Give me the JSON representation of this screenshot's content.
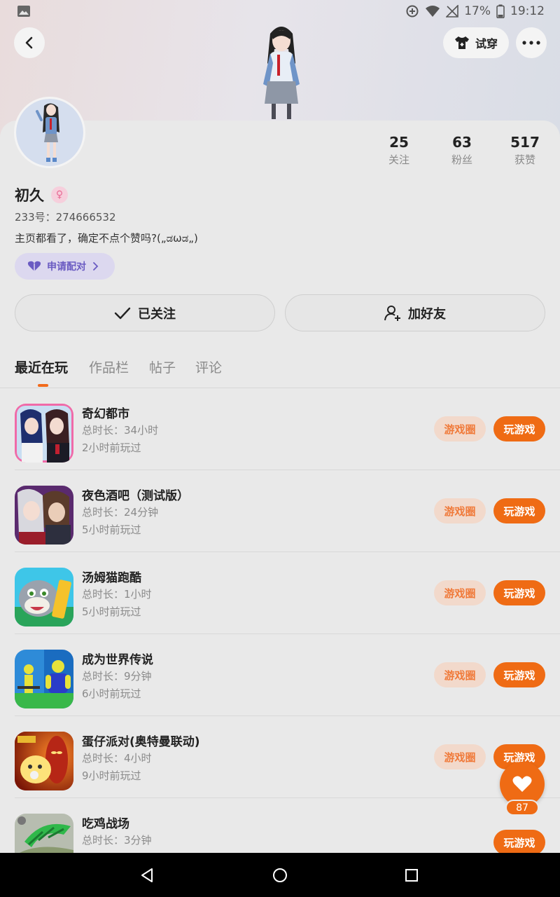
{
  "status_bar": {
    "battery": "17%",
    "time": "19:12"
  },
  "header": {
    "try_on_label": "试穿"
  },
  "profile": {
    "stats": [
      {
        "value": "25",
        "label": "关注"
      },
      {
        "value": "63",
        "label": "粉丝"
      },
      {
        "value": "517",
        "label": "获赞"
      }
    ],
    "name": "初久",
    "gender_symbol": "♀",
    "uid": "233号：274666532",
    "bio": "主页都看了，确定不点个赞吗?(„ಡωಡ„)",
    "match_label": "申请配对",
    "follow_label": "已关注",
    "add_friend_label": "加好友"
  },
  "tabs": [
    "最近在玩",
    "作品栏",
    "帖子",
    "评论"
  ],
  "games": [
    {
      "name": "奇幻都市",
      "duration": "总时长：34小时",
      "last_played": "2小时前玩过",
      "circle_label": "游戏圈",
      "play_label": "玩游戏"
    },
    {
      "name": "夜色酒吧（测试版）",
      "duration": "总时长：24分钟",
      "last_played": "5小时前玩过",
      "circle_label": "游戏圈",
      "play_label": "玩游戏"
    },
    {
      "name": "汤姆猫跑酷",
      "duration": "总时长：1小时",
      "last_played": "5小时前玩过",
      "circle_label": "游戏圈",
      "play_label": "玩游戏"
    },
    {
      "name": "成为世界传说",
      "duration": "总时长：9分钟",
      "last_played": "6小时前玩过",
      "circle_label": "游戏圈",
      "play_label": "玩游戏"
    },
    {
      "name": "蛋仔派对(奥特曼联动)",
      "duration": "总时长：4小时",
      "last_played": "9小时前玩过",
      "circle_label": "游戏圈",
      "play_label": "玩游戏"
    },
    {
      "name": "吃鸡战场",
      "duration": "总时长：3分钟",
      "play_label": "玩游戏"
    }
  ],
  "like_count": "87",
  "colors": {
    "accent": "#ef6b14",
    "accent_light": "#f2d9cb",
    "match_purple": "#6a5bc2"
  }
}
